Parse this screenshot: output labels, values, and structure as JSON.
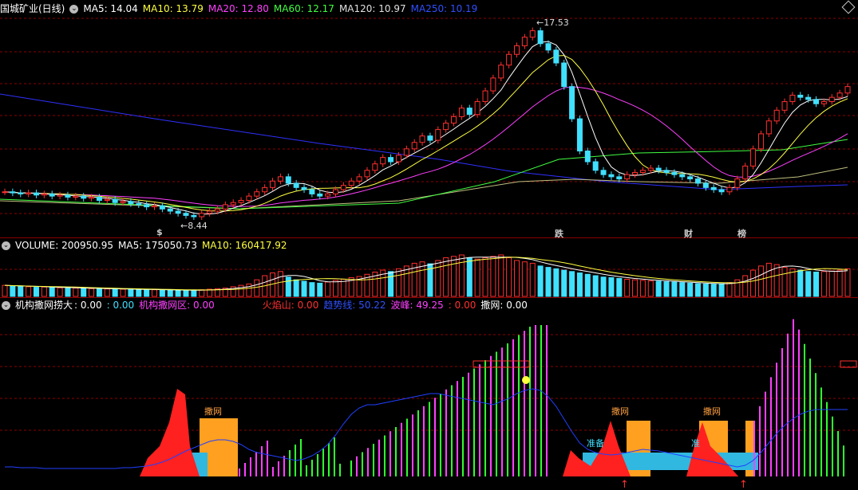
{
  "price_header": {
    "title": "国城矿业(日线)",
    "ma5": "MA5: 14.04",
    "ma10": "MA10: 13.79",
    "ma20": "MA20: 12.80",
    "ma60": "MA60: 12.17",
    "ma120": "MA120: 10.97",
    "ma250": "MA250: 10.19"
  },
  "volume_header": {
    "volume": "VOLUME: 200950.95",
    "ma5": "MA5: 175050.73",
    "ma10": "MA10: 160417.92"
  },
  "indicator_header": {
    "name": "机构撒网捞大",
    "v1": ": 0.00",
    "v2": ": 0.00",
    "zone": "机构撒网区: 0.00",
    "volcano": "火焰山: 0.00",
    "trend": "趋势线: 50.22",
    "wave": "波峰: 49.25",
    "v3": ": 0.00",
    "net": "撒网: 0.00"
  },
  "price_labels": {
    "high": "17.53",
    "low": "8.44"
  },
  "event_markers": [
    {
      "text": "$",
      "color": "#ff3030"
    },
    {
      "text": "跌",
      "color": "#30ff30"
    },
    {
      "text": "财",
      "color": "#5fb0ff"
    },
    {
      "text": "榜",
      "color": "#ffa040"
    }
  ],
  "indicator_labels": {
    "net1": "撒网",
    "net2": "撒网",
    "net3": "撒网",
    "ready1": "准备",
    "ready2": "准"
  },
  "colors": {
    "up": "#ff3030",
    "down": "#40e0ff",
    "ma5": "#ffffff",
    "ma10": "#ffff40",
    "ma20": "#ff40ff",
    "ma60": "#40ff40",
    "ma120": "#c0c080",
    "ma250": "#3030ff",
    "grid": "#8b0000"
  },
  "chart_data": {
    "type": "candlestick",
    "price_range": [
      8.44,
      17.53
    ],
    "closes": [
      9.6,
      9.55,
      9.5,
      9.55,
      9.45,
      9.5,
      9.4,
      9.45,
      9.35,
      9.4,
      9.3,
      9.35,
      9.2,
      9.25,
      9.1,
      9.15,
      9.05,
      9.0,
      8.9,
      8.95,
      8.8,
      8.7,
      8.6,
      8.5,
      8.44,
      8.6,
      8.7,
      8.8,
      9.0,
      9.1,
      9.2,
      9.4,
      9.6,
      9.8,
      10.1,
      10.3,
      10.0,
      9.8,
      9.7,
      9.5,
      9.4,
      9.5,
      9.7,
      9.9,
      10.1,
      10.3,
      10.6,
      10.9,
      11.2,
      11.0,
      11.3,
      11.6,
      11.9,
      12.2,
      12.0,
      12.5,
      12.8,
      13.1,
      13.5,
      13.2,
      13.8,
      14.3,
      14.9,
      15.5,
      16.0,
      16.4,
      16.8,
      17.1,
      16.5,
      16.2,
      15.6,
      14.5,
      13.0,
      11.5,
      11.0,
      10.6,
      10.4,
      10.3,
      10.2,
      10.4,
      10.5,
      10.6,
      10.7,
      10.6,
      10.5,
      10.4,
      10.3,
      10.2,
      10.0,
      9.8,
      9.7,
      9.6,
      9.8,
      10.2,
      10.8,
      11.6,
      12.3,
      12.9,
      13.4,
      13.8,
      14.1,
      14.0,
      13.9,
      13.7,
      13.8,
      14.0,
      14.2,
      14.5
    ],
    "volumes": [
      40,
      38,
      36,
      35,
      33,
      34,
      32,
      31,
      30,
      30,
      29,
      28,
      28,
      27,
      26,
      26,
      25,
      25,
      24,
      24,
      23,
      23,
      22,
      22,
      22,
      24,
      26,
      28,
      30,
      35,
      40,
      45,
      60,
      75,
      85,
      90,
      70,
      60,
      55,
      50,
      48,
      52,
      58,
      62,
      68,
      72,
      80,
      88,
      95,
      90,
      100,
      110,
      120,
      125,
      118,
      130,
      140,
      145,
      150,
      140,
      135,
      140,
      145,
      150,
      140,
      130,
      125,
      120,
      110,
      105,
      100,
      95,
      90,
      85,
      80,
      75,
      70,
      68,
      65,
      62,
      60,
      58,
      56,
      55,
      53,
      52,
      50,
      48,
      46,
      45,
      44,
      46,
      50,
      60,
      75,
      95,
      110,
      120,
      115,
      105,
      100,
      95,
      90,
      88,
      90,
      92,
      95,
      100
    ],
    "indicator_series": {
      "trend_line": [
        12,
        12,
        11,
        11,
        11,
        10,
        10,
        10,
        10,
        10,
        10,
        10,
        10,
        10,
        10,
        11,
        11,
        12,
        13,
        15,
        18,
        22,
        27,
        32,
        36,
        40,
        44,
        46,
        46,
        44,
        40,
        34,
        30,
        28,
        26,
        24,
        22,
        20,
        22,
        26,
        32,
        40,
        52,
        66,
        78,
        86,
        90,
        90,
        92,
        94,
        96,
        98,
        100,
        102,
        104,
        104,
        102,
        100,
        98,
        96,
        94,
        92,
        90,
        94,
        98,
        104,
        108,
        110,
        108,
        100,
        88,
        72,
        56,
        42,
        34,
        30,
        28,
        27,
        28,
        30,
        32,
        34,
        33,
        32,
        30,
        28,
        26,
        24,
        22,
        20,
        18,
        16,
        14,
        12,
        14,
        20,
        30,
        42,
        54,
        64,
        72,
        78,
        82,
        84,
        84,
        84,
        84,
        84
      ]
    }
  }
}
